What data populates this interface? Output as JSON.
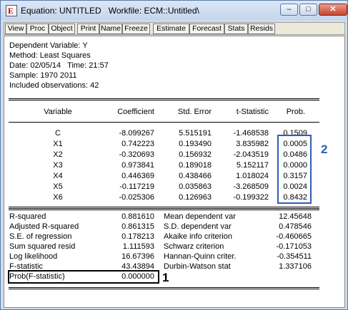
{
  "window": {
    "title": "Equation: UNTITLED   Workfile: ECM::Untitled\\",
    "controls": [
      "minimize",
      "maximize",
      "close"
    ]
  },
  "toolbar": {
    "buttons": [
      "View",
      "Proc",
      "Object",
      "Print",
      "Name",
      "Freeze",
      "Estimate",
      "Forecast",
      "Stats",
      "Resids"
    ]
  },
  "output": {
    "header": [
      "Dependent Variable: Y",
      "Method: Least Squares",
      "Date: 02/05/14   Time: 21:57",
      "Sample: 1970 2011",
      "Included observations: 42"
    ],
    "columns": [
      "Variable",
      "Coefficient",
      "Std. Error",
      "t-Statistic",
      "Prob."
    ],
    "rows": [
      [
        "C",
        "-8.099267",
        "5.515191",
        "-1.468538",
        "0.1509"
      ],
      [
        "X1",
        "0.742223",
        "0.193490",
        "3.835982",
        "0.0005"
      ],
      [
        "X2",
        "-0.320693",
        "0.156932",
        "-2.043519",
        "0.0486"
      ],
      [
        "X3",
        "0.973841",
        "0.189018",
        "5.152117",
        "0.0000"
      ],
      [
        "X4",
        "0.446369",
        "0.438466",
        "1.018024",
        "0.3157"
      ],
      [
        "X5",
        "-0.117219",
        "0.035863",
        "-3.268509",
        "0.0024"
      ],
      [
        "X6",
        "-0.025306",
        "0.126963",
        "-0.199322",
        "0.8432"
      ]
    ],
    "stats": [
      [
        "R-squared",
        "0.881610",
        "Mean dependent var",
        "12.45648"
      ],
      [
        "Adjusted R-squared",
        "0.861315",
        "S.D. dependent var",
        "0.478546"
      ],
      [
        "S.E. of regression",
        "0.178213",
        "Akaike info criterion",
        "-0.460665"
      ],
      [
        "Sum squared resid",
        "1.111593",
        "Schwarz criterion",
        "-0.171053"
      ],
      [
        "Log likelihood",
        "16.67396",
        "Hannan-Quinn criter.",
        "-0.354511"
      ],
      [
        "F-statistic",
        "43.43894",
        "Durbin-Watson stat",
        "1.337106"
      ],
      [
        "Prob(F-statistic)",
        "0.000000",
        "",
        ""
      ]
    ]
  },
  "annotations": {
    "prob_box_label": "2",
    "fstat_box_label": "1",
    "blue_color": "#2f5db3",
    "black_color": "#000000"
  }
}
